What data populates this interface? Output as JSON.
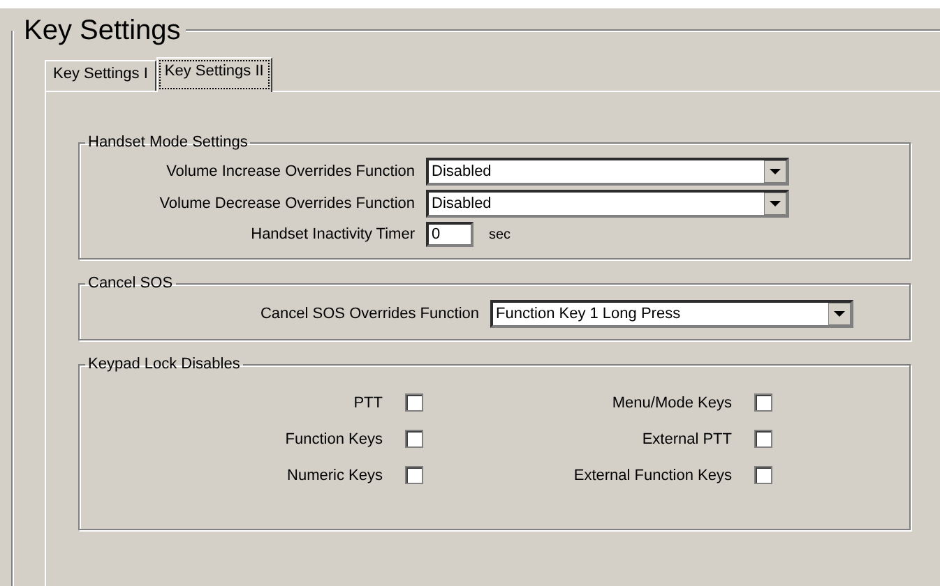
{
  "title": "Key Settings",
  "tabs": [
    {
      "label": "Key Settings I",
      "selected": false
    },
    {
      "label": "Key Settings II",
      "selected": true
    }
  ],
  "handset_mode": {
    "title": "Handset Mode Settings",
    "fields": [
      {
        "kind": "dropdown",
        "label": "Volume Increase Overrides Function",
        "value": "Disabled"
      },
      {
        "kind": "dropdown",
        "label": "Volume Decrease Overrides Function",
        "value": "Disabled"
      },
      {
        "kind": "number",
        "label": "Handset Inactivity Timer",
        "value": "0",
        "unit": "sec"
      }
    ]
  },
  "cancel_sos": {
    "title": "Cancel SOS",
    "fields": [
      {
        "kind": "dropdown",
        "label": "Cancel SOS Overrides Function",
        "value": "Function Key 1 Long Press"
      }
    ]
  },
  "keypad_lock": {
    "title": "Keypad Lock Disables",
    "left": [
      {
        "label": "PTT",
        "checked": false
      },
      {
        "label": "Function Keys",
        "checked": false
      },
      {
        "label": "Numeric Keys",
        "checked": false
      }
    ],
    "right": [
      {
        "label": "Menu/Mode Keys",
        "checked": false
      },
      {
        "label": "External PTT",
        "checked": false
      },
      {
        "label": "External Function Keys",
        "checked": false
      }
    ]
  }
}
